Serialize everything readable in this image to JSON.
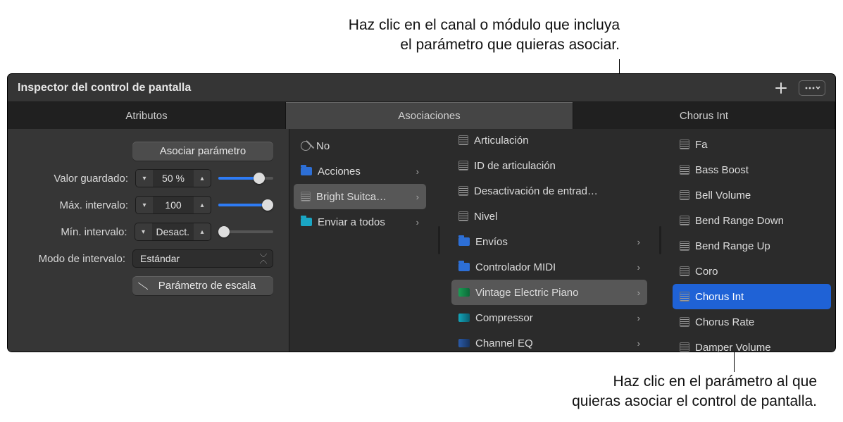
{
  "annotations": {
    "topLine1": "Haz clic en el canal o módulo que incluya",
    "topLine2": "el parámetro que quieras asociar.",
    "bottomLine1": "Haz clic en el parámetro al que",
    "bottomLine2": "quieras asociar el control de pantalla."
  },
  "title": "Inspector del control de pantalla",
  "tabs": {
    "attrs": "Atributos",
    "assoc": "Asociaciones",
    "param": "Chorus Int"
  },
  "attrs": {
    "assoc_btn": "Asociar parámetro",
    "saved_label": "Valor guardado:",
    "saved_value": "50 %",
    "max_label": "Máx. intervalo:",
    "max_value": "100",
    "min_label": "Mín. intervalo:",
    "min_value": "Desact.",
    "mode_label": "Modo de intervalo:",
    "mode_value": "Estándar",
    "scale_btn": "Parámetro de escala"
  },
  "col1": {
    "none": "No",
    "actions": "Acciones",
    "bright": "Bright Suitca…",
    "sendall": "Enviar a todos"
  },
  "col2": {
    "articulacion": "Articulación",
    "artid": "ID de articulación",
    "deact": "Desactivación de entrad…",
    "nivel": "Nivel",
    "envios": "Envíos",
    "midi": "Controlador MIDI",
    "vep": "Vintage Electric Piano",
    "comp": "Compressor",
    "cheq": "Channel EQ"
  },
  "col3": {
    "fa": "Fa",
    "bassboost": "Bass Boost",
    "bellvol": "Bell Volume",
    "bendDown": "Bend Range Down",
    "bendUp": "Bend Range Up",
    "coro": "Coro",
    "chorusInt": "Chorus Int",
    "chorusRate": "Chorus Rate",
    "damper": "Damper Volume"
  }
}
